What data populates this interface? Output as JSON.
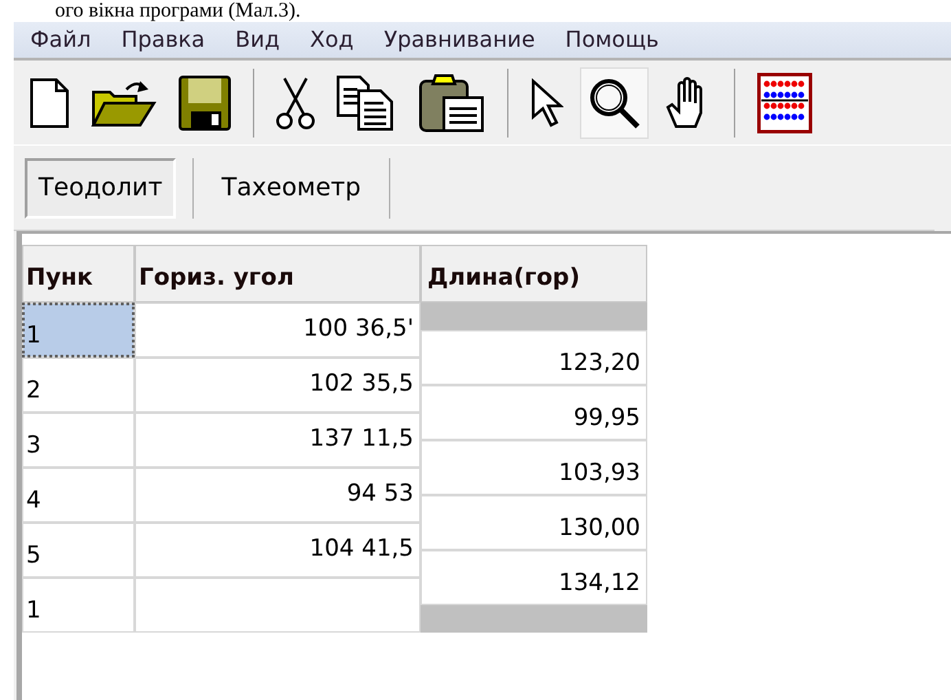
{
  "caption": "ого вікна програми (Мал.3).",
  "menu": [
    "Файл",
    "Правка",
    "Вид",
    "Ход",
    "Уравнивание",
    "Помощь"
  ],
  "toolbar": [
    {
      "kind": "new",
      "selected": false
    },
    {
      "kind": "open",
      "selected": false
    },
    {
      "kind": "save",
      "selected": false
    },
    {
      "kind": "sep"
    },
    {
      "kind": "cut",
      "selected": false
    },
    {
      "kind": "copy",
      "selected": false
    },
    {
      "kind": "paste",
      "selected": false
    },
    {
      "kind": "sep"
    },
    {
      "kind": "pointer",
      "selected": false
    },
    {
      "kind": "zoom",
      "selected": true
    },
    {
      "kind": "hand",
      "selected": false
    },
    {
      "kind": "sep"
    },
    {
      "kind": "abacus",
      "selected": false
    }
  ],
  "tabs": [
    {
      "label": "Теодолит",
      "selected": true
    },
    {
      "label": "Тахеометр",
      "selected": false
    }
  ],
  "table": {
    "columns": [
      "Пунк",
      "Гориз. угол",
      "Длина(гор)"
    ],
    "rows": [
      {
        "point": "1",
        "angle": "100 36,5'",
        "selected": true
      },
      {
        "point": "2",
        "angle": "102 35,5",
        "selected": false
      },
      {
        "point": "3",
        "angle": "137 11,5",
        "selected": false
      },
      {
        "point": "4",
        "angle": "94 53",
        "selected": false
      },
      {
        "point": "5",
        "angle": "104 41,5",
        "selected": false
      },
      {
        "point": "1",
        "selected": false
      }
    ],
    "lengths": [
      "123,20",
      "99,95",
      "103,93",
      "130,00",
      "134,12"
    ]
  }
}
